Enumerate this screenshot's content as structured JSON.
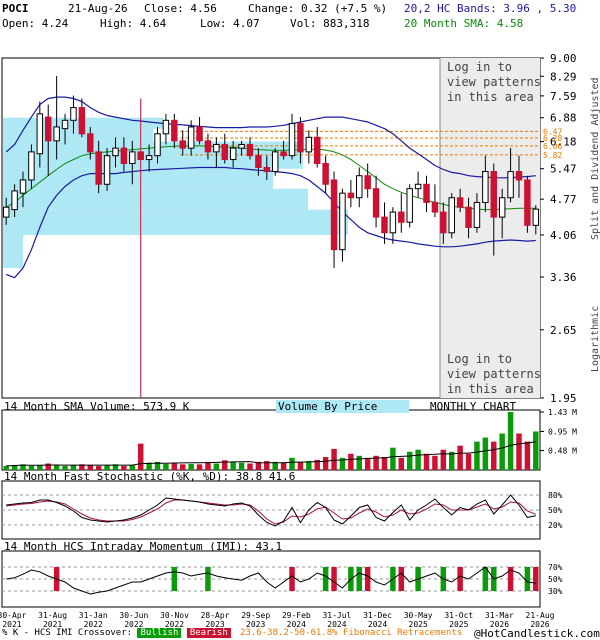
{
  "header": {
    "symbol": "POCI",
    "date": "21-Aug-26",
    "close_label": "Close: 4.56",
    "change_label": "Change: 0.32 (+7.5 %)",
    "open_label": "Open: 4.24",
    "high_label": "High: 4.64",
    "low_label": "Low: 4.07",
    "vol_label": "Vol: 883,318",
    "bands_label": "20,2 HC Bands: 3.96 , 5.30",
    "sma_label": "20 Month SMA: 4.58"
  },
  "colors": {
    "up": "#0a9a0a",
    "down": "#cc1133",
    "band": "#1a1aa6",
    "sma": "#0a8a0a",
    "vbp": "#aee8f5",
    "fib": "#f07800",
    "stoch_k": "#000000",
    "stoch_d": "#aa1133"
  },
  "watermarks": {
    "top": [
      "Log in to",
      "view patterns",
      "in this area"
    ],
    "bottom": [
      "Log in to",
      "view patterns",
      "in this area"
    ]
  },
  "side_labels": {
    "adjusted": "Split and Dividend Adjusted",
    "log": "Logarithmic"
  },
  "panels": {
    "volume": {
      "title": "14 Month SMA Volume: 573.9 K",
      "vbp": "Volume By Price",
      "monthly": "MONTHLY CHART",
      "ticks": [
        "1.43 M",
        "0.95 M",
        "0.48 M"
      ]
    },
    "stoch": {
      "title": "14 Month Fast Stochastic (%K, %D): 38.8  41.6",
      "ticks": [
        "80%",
        "50%",
        "20%"
      ]
    },
    "imi": {
      "title": "14 Month HCS Intraday Momentum (IMI): 43.1",
      "ticks": [
        "70%",
        "50%",
        "30%"
      ]
    }
  },
  "footer": {
    "prefix": "% K - HCS IMI Crossover:",
    "bullish": "Bullish",
    "bearish": "Bearish",
    "fib": "23.6-38.2-50-61.8% Fibonacci Retracements",
    "brand": "@HotCandlestick.com"
  },
  "chart_data": {
    "type": "candlestick",
    "scale": "log",
    "ylim": [
      1.95,
      9.0
    ],
    "price_ticks": [
      "9.00",
      "8.29",
      "7.59",
      "6.88",
      "6.18",
      "5.47",
      "4.77",
      "4.06",
      "3.36",
      "2.65",
      "1.95"
    ],
    "fib_levels": [
      "6.47",
      "6.28",
      "6.06",
      "5.82"
    ],
    "x_ticks": [
      "30-Apr 2021",
      "31-Aug 2021",
      "31-Jan 2022",
      "30-Jun 2022",
      "30-Nov 2022",
      "28-Apr 2023",
      "29-Sep 2023",
      "29-Feb 2024",
      "31-Jul 2024",
      "31-Dec 2024",
      "30-May 2025",
      "31-Oct 2025",
      "31-Mar 2026",
      "21-Aug 2026"
    ],
    "candles": [
      {
        "o": 4.4,
        "h": 4.8,
        "l": 4.25,
        "c": 4.6
      },
      {
        "o": 4.55,
        "h": 5.1,
        "l": 4.4,
        "c": 4.95
      },
      {
        "o": 4.9,
        "h": 5.4,
        "l": 4.6,
        "c": 5.2
      },
      {
        "o": 5.2,
        "h": 6.1,
        "l": 5.0,
        "c": 5.9
      },
      {
        "o": 5.85,
        "h": 7.4,
        "l": 5.5,
        "c": 7.0
      },
      {
        "o": 6.9,
        "h": 7.3,
        "l": 5.3,
        "c": 6.2
      },
      {
        "o": 6.2,
        "h": 8.3,
        "l": 5.7,
        "c": 6.6
      },
      {
        "o": 6.55,
        "h": 7.0,
        "l": 6.1,
        "c": 6.8
      },
      {
        "o": 6.8,
        "h": 7.6,
        "l": 6.4,
        "c": 7.2
      },
      {
        "o": 7.2,
        "h": 7.5,
        "l": 6.3,
        "c": 6.4
      },
      {
        "o": 6.4,
        "h": 6.6,
        "l": 5.7,
        "c": 5.9
      },
      {
        "o": 5.9,
        "h": 6.2,
        "l": 4.9,
        "c": 5.1
      },
      {
        "o": 5.1,
        "h": 6.0,
        "l": 4.95,
        "c": 5.8
      },
      {
        "o": 5.8,
        "h": 6.3,
        "l": 5.5,
        "c": 6.0
      },
      {
        "o": 6.0,
        "h": 6.3,
        "l": 5.4,
        "c": 5.6
      },
      {
        "o": 5.6,
        "h": 6.2,
        "l": 5.1,
        "c": 5.9
      },
      {
        "o": 5.9,
        "h": 7.5,
        "l": 1.95,
        "c": 5.7
      },
      {
        "o": 5.7,
        "h": 6.1,
        "l": 5.4,
        "c": 5.8
      },
      {
        "o": 5.8,
        "h": 6.6,
        "l": 5.6,
        "c": 6.4
      },
      {
        "o": 6.4,
        "h": 7.0,
        "l": 6.1,
        "c": 6.8
      },
      {
        "o": 6.8,
        "h": 7.0,
        "l": 6.0,
        "c": 6.2
      },
      {
        "o": 6.2,
        "h": 6.5,
        "l": 5.8,
        "c": 6.0
      },
      {
        "o": 6.0,
        "h": 6.8,
        "l": 5.8,
        "c": 6.6
      },
      {
        "o": 6.6,
        "h": 6.9,
        "l": 6.1,
        "c": 6.2
      },
      {
        "o": 6.2,
        "h": 6.4,
        "l": 5.7,
        "c": 5.9
      },
      {
        "o": 5.9,
        "h": 6.3,
        "l": 5.5,
        "c": 6.1
      },
      {
        "o": 6.1,
        "h": 6.4,
        "l": 5.6,
        "c": 5.7
      },
      {
        "o": 5.7,
        "h": 6.2,
        "l": 5.5,
        "c": 6.0
      },
      {
        "o": 6.0,
        "h": 6.2,
        "l": 5.8,
        "c": 6.1
      },
      {
        "o": 6.1,
        "h": 6.3,
        "l": 5.7,
        "c": 5.8
      },
      {
        "o": 5.8,
        "h": 6.0,
        "l": 5.3,
        "c": 5.5
      },
      {
        "o": 5.5,
        "h": 5.8,
        "l": 5.2,
        "c": 5.4
      },
      {
        "o": 5.4,
        "h": 6.0,
        "l": 5.3,
        "c": 5.9
      },
      {
        "o": 5.9,
        "h": 6.2,
        "l": 5.7,
        "c": 5.8
      },
      {
        "o": 5.8,
        "h": 7.0,
        "l": 5.7,
        "c": 6.7
      },
      {
        "o": 6.7,
        "h": 6.9,
        "l": 5.6,
        "c": 5.9
      },
      {
        "o": 5.9,
        "h": 6.5,
        "l": 5.6,
        "c": 6.3
      },
      {
        "o": 6.3,
        "h": 6.6,
        "l": 5.5,
        "c": 5.6
      },
      {
        "o": 5.6,
        "h": 5.8,
        "l": 4.9,
        "c": 5.1
      },
      {
        "o": 5.2,
        "h": 5.4,
        "l": 3.5,
        "c": 3.8
      },
      {
        "o": 3.8,
        "h": 5.0,
        "l": 3.6,
        "c": 4.9
      },
      {
        "o": 4.9,
        "h": 5.2,
        "l": 4.6,
        "c": 4.8
      },
      {
        "o": 4.8,
        "h": 5.5,
        "l": 4.6,
        "c": 5.3
      },
      {
        "o": 5.3,
        "h": 5.6,
        "l": 4.8,
        "c": 5.0
      },
      {
        "o": 5.0,
        "h": 5.3,
        "l": 4.2,
        "c": 4.4
      },
      {
        "o": 4.4,
        "h": 4.7,
        "l": 3.9,
        "c": 4.1
      },
      {
        "o": 4.1,
        "h": 4.6,
        "l": 3.9,
        "c": 4.5
      },
      {
        "o": 4.5,
        "h": 4.9,
        "l": 4.1,
        "c": 4.3
      },
      {
        "o": 4.3,
        "h": 5.1,
        "l": 4.2,
        "c": 5.0
      },
      {
        "o": 5.0,
        "h": 5.4,
        "l": 4.8,
        "c": 5.1
      },
      {
        "o": 5.1,
        "h": 5.3,
        "l": 4.5,
        "c": 4.7
      },
      {
        "o": 4.7,
        "h": 5.1,
        "l": 4.4,
        "c": 4.5
      },
      {
        "o": 4.5,
        "h": 4.7,
        "l": 3.9,
        "c": 4.1
      },
      {
        "o": 4.1,
        "h": 4.9,
        "l": 4.0,
        "c": 4.8
      },
      {
        "o": 4.8,
        "h": 5.0,
        "l": 4.5,
        "c": 4.6
      },
      {
        "o": 4.6,
        "h": 4.8,
        "l": 4.0,
        "c": 4.2
      },
      {
        "o": 4.2,
        "h": 4.9,
        "l": 4.1,
        "c": 4.7
      },
      {
        "o": 4.7,
        "h": 5.8,
        "l": 4.5,
        "c": 5.4
      },
      {
        "o": 5.4,
        "h": 5.6,
        "l": 3.7,
        "c": 4.4
      },
      {
        "o": 4.4,
        "h": 5.0,
        "l": 4.0,
        "c": 4.8
      },
      {
        "o": 4.8,
        "h": 6.0,
        "l": 4.7,
        "c": 5.4
      },
      {
        "o": 5.4,
        "h": 5.8,
        "l": 4.8,
        "c": 5.2
      },
      {
        "o": 5.2,
        "h": 5.3,
        "l": 4.1,
        "c": 4.24
      },
      {
        "o": 4.24,
        "h": 4.64,
        "l": 4.07,
        "c": 4.56
      }
    ],
    "upper_band": [
      5.9,
      6.1,
      6.5,
      6.9,
      7.3,
      7.5,
      7.55,
      7.55,
      7.5,
      7.4,
      7.2,
      7.05,
      6.95,
      6.9,
      6.85,
      6.8,
      6.78,
      6.75,
      6.72,
      6.7,
      6.68,
      6.66,
      6.64,
      6.62,
      6.6,
      6.58,
      6.58,
      6.58,
      6.58,
      6.6,
      6.6,
      6.6,
      6.62,
      6.65,
      6.7,
      6.75,
      6.8,
      6.85,
      6.9,
      6.9,
      6.9,
      6.85,
      6.8,
      6.75,
      6.65,
      6.55,
      6.4,
      6.2,
      6.0,
      5.85,
      5.7,
      5.55,
      5.45,
      5.38,
      5.35,
      5.3,
      5.28,
      5.27,
      5.25,
      5.25,
      5.25,
      5.27,
      5.28,
      5.3
    ],
    "lower_band": [
      3.4,
      3.35,
      3.5,
      3.8,
      4.2,
      4.6,
      4.85,
      5.05,
      5.2,
      5.3,
      5.35,
      5.35,
      5.35,
      5.35,
      5.38,
      5.4,
      5.42,
      5.44,
      5.45,
      5.46,
      5.47,
      5.48,
      5.49,
      5.5,
      5.5,
      5.5,
      5.5,
      5.48,
      5.47,
      5.45,
      5.43,
      5.42,
      5.4,
      5.38,
      5.35,
      5.3,
      5.2,
      5.05,
      4.9,
      4.7,
      4.5,
      4.35,
      4.2,
      4.1,
      4.05,
      4.0,
      3.97,
      3.95,
      3.93,
      3.9,
      3.88,
      3.86,
      3.85,
      3.85,
      3.86,
      3.88,
      3.9,
      3.93,
      3.95,
      3.96,
      3.97,
      3.96,
      3.95,
      3.96
    ],
    "sma": [
      4.6,
      4.7,
      4.85,
      5.0,
      5.15,
      5.3,
      5.45,
      5.6,
      5.7,
      5.8,
      5.85,
      5.88,
      5.9,
      5.92,
      5.94,
      5.96,
      5.98,
      6.0,
      6.02,
      6.04,
      6.05,
      6.06,
      6.06,
      6.06,
      6.05,
      6.04,
      6.03,
      6.02,
      6.0,
      5.98,
      5.96,
      5.95,
      5.94,
      5.94,
      5.95,
      5.96,
      5.97,
      5.97,
      5.95,
      5.9,
      5.82,
      5.7,
      5.55,
      5.4,
      5.25,
      5.1,
      5.0,
      4.92,
      4.85,
      4.8,
      4.75,
      4.7,
      4.66,
      4.62,
      4.6,
      4.58,
      4.56,
      4.55,
      4.55,
      4.56,
      4.57,
      4.58,
      4.58,
      4.58
    ],
    "volume": [
      0.1,
      0.12,
      0.14,
      0.1,
      0.12,
      0.16,
      0.12,
      0.1,
      0.12,
      0.14,
      0.12,
      0.1,
      0.12,
      0.14,
      0.1,
      0.12,
      0.65,
      0.18,
      0.2,
      0.15,
      0.16,
      0.14,
      0.15,
      0.14,
      0.2,
      0.16,
      0.24,
      0.2,
      0.18,
      0.16,
      0.2,
      0.22,
      0.2,
      0.18,
      0.3,
      0.2,
      0.22,
      0.25,
      0.32,
      0.52,
      0.3,
      0.4,
      0.35,
      0.3,
      0.35,
      0.32,
      0.55,
      0.3,
      0.45,
      0.5,
      0.4,
      0.35,
      0.5,
      0.45,
      0.6,
      0.4,
      0.7,
      0.8,
      0.7,
      0.9,
      1.43,
      0.9,
      0.7,
      0.95
    ],
    "stoch_k": [
      60,
      62,
      64,
      65,
      70,
      70,
      65,
      58,
      48,
      35,
      30,
      28,
      26,
      28,
      30,
      34,
      40,
      50,
      60,
      74,
      72,
      70,
      68,
      66,
      62,
      60,
      58,
      62,
      64,
      58,
      40,
      25,
      18,
      28,
      55,
      25,
      50,
      65,
      55,
      30,
      22,
      38,
      55,
      60,
      35,
      28,
      45,
      60,
      30,
      50,
      60,
      72,
      55,
      40,
      55,
      50,
      62,
      70,
      42,
      60,
      80,
      60,
      35,
      38.8
    ],
    "stoch_d": [
      58,
      60,
      62,
      63,
      66,
      68,
      66,
      62,
      52,
      42,
      34,
      30,
      28,
      28,
      28,
      31,
      36,
      44,
      52,
      64,
      70,
      70,
      68,
      66,
      64,
      62,
      60,
      60,
      62,
      60,
      48,
      32,
      22,
      26,
      38,
      36,
      42,
      52,
      56,
      44,
      32,
      34,
      44,
      52,
      46,
      36,
      40,
      50,
      42,
      44,
      52,
      62,
      60,
      50,
      50,
      50,
      56,
      62,
      52,
      56,
      66,
      64,
      48,
      41.6
    ],
    "imi": [
      50,
      52,
      58,
      65,
      62,
      55,
      50,
      45,
      35,
      30,
      25,
      28,
      30,
      35,
      40,
      45,
      45,
      50,
      55,
      60,
      62,
      60,
      55,
      58,
      60,
      55,
      52,
      50,
      48,
      55,
      60,
      45,
      35,
      45,
      55,
      45,
      50,
      60,
      55,
      45,
      35,
      50,
      60,
      55,
      45,
      40,
      50,
      60,
      45,
      50,
      55,
      60,
      50,
      45,
      55,
      50,
      60,
      70,
      50,
      55,
      65,
      60,
      45,
      43.1
    ],
    "imi_markers": [
      {
        "i": 6,
        "t": "bear"
      },
      {
        "i": 20,
        "t": "bull"
      },
      {
        "i": 24,
        "t": "bull"
      },
      {
        "i": 34,
        "t": "bear"
      },
      {
        "i": 38,
        "t": "bull"
      },
      {
        "i": 39,
        "t": "bear"
      },
      {
        "i": 41,
        "t": "bull"
      },
      {
        "i": 42,
        "t": "bull"
      },
      {
        "i": 43,
        "t": "bear"
      },
      {
        "i": 46,
        "t": "bull"
      },
      {
        "i": 47,
        "t": "bear"
      },
      {
        "i": 49,
        "t": "bull"
      },
      {
        "i": 52,
        "t": "bull"
      },
      {
        "i": 54,
        "t": "bear"
      },
      {
        "i": 57,
        "t": "bull"
      },
      {
        "i": 58,
        "t": "bull"
      },
      {
        "i": 60,
        "t": "bear"
      },
      {
        "i": 62,
        "t": "bull"
      },
      {
        "i": 63,
        "t": "bear"
      }
    ]
  }
}
